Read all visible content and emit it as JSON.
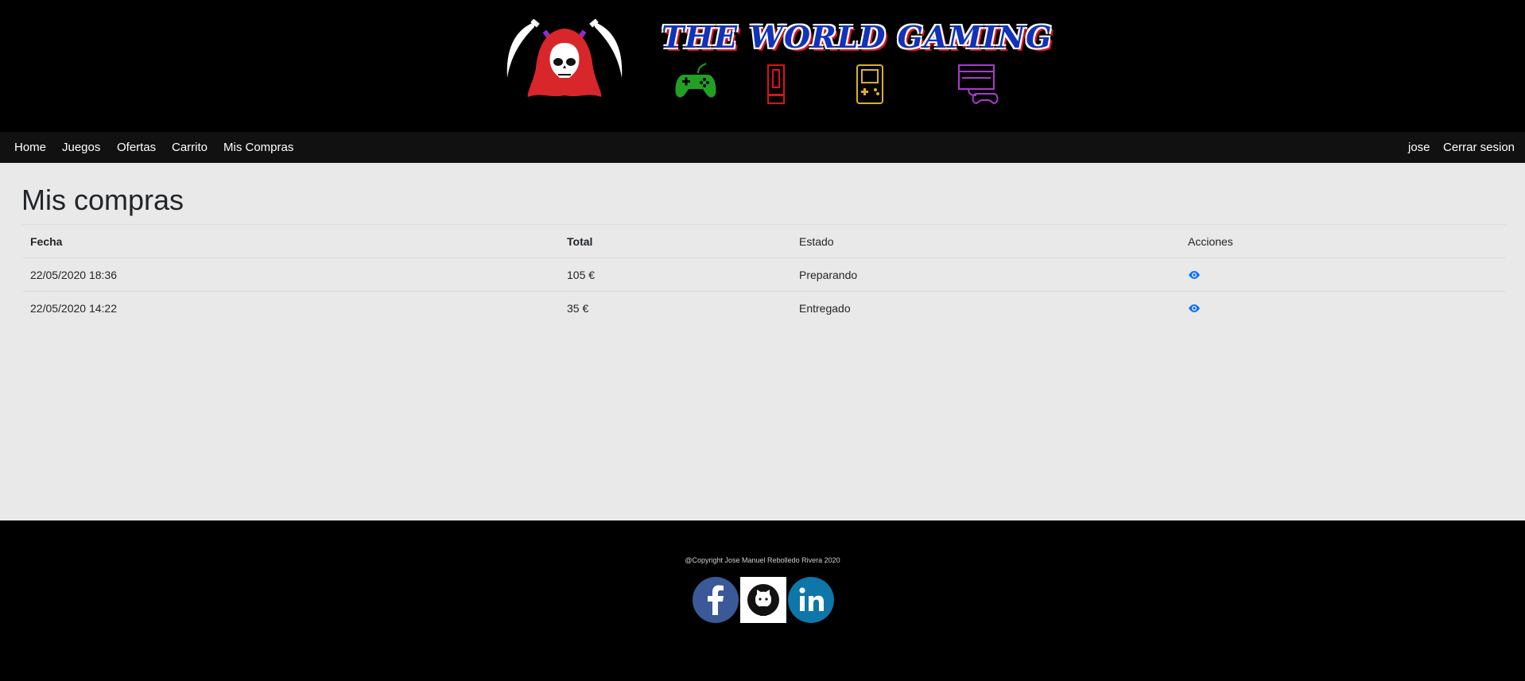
{
  "header": {
    "brand_title": "THE WORLD GAMING",
    "icons": [
      "reaper-logo-icon",
      "gamepad-icon",
      "arcade-icon",
      "handheld-console-icon",
      "retro-console-icon"
    ],
    "colors": {
      "title": "#1233b8",
      "title_shadow": "#d8141a",
      "gamepad": "#22a022",
      "arcade": "#d8141a",
      "handheld": "#d9b030",
      "retro": "#a83ccc"
    }
  },
  "nav": {
    "items": [
      {
        "label": "Home"
      },
      {
        "label": "Juegos"
      },
      {
        "label": "Ofertas"
      },
      {
        "label": "Carrito"
      },
      {
        "label": "Mis Compras"
      }
    ],
    "user": "jose",
    "logout": "Cerrar sesion"
  },
  "main": {
    "title": "Mis compras",
    "table": {
      "headers": [
        "Fecha",
        "Total",
        "Estado",
        "Acciones"
      ],
      "rows": [
        {
          "fecha": "22/05/2020 18:36",
          "total": "105 €",
          "estado": "Preparando",
          "action_icon": "eye-icon"
        },
        {
          "fecha": "22/05/2020 14:22",
          "total": "35 €",
          "estado": "Entregado",
          "action_icon": "eye-icon"
        }
      ]
    }
  },
  "footer": {
    "copyright": "@Copyright Jose Manuel Rebolledo Rivera 2020",
    "social": [
      "facebook-icon",
      "github-icon",
      "linkedin-icon"
    ],
    "colors": {
      "facebook": "#3b5998",
      "github_bg": "#ffffff",
      "linkedin": "#0e76a8",
      "accent": "#0d6efd"
    }
  }
}
